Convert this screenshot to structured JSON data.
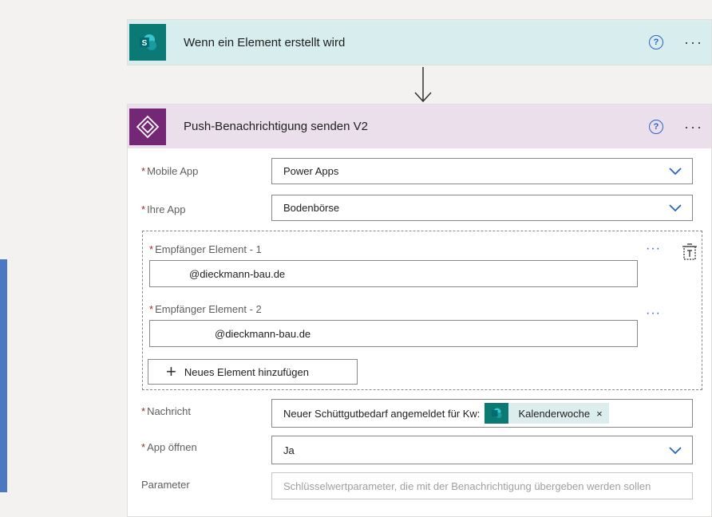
{
  "trigger": {
    "title": "Wenn ein Element erstellt wird",
    "icon": "sharepoint-icon",
    "help": "?",
    "more": "···"
  },
  "action": {
    "title": "Push-Benachrichtigung senden V2",
    "icon": "powerapps-icon",
    "help": "?",
    "more": "···",
    "required_marker": "*",
    "mobile_app": {
      "label": "Mobile App",
      "value": "Power Apps"
    },
    "ihre_app": {
      "label": "Ihre App",
      "value": "Bodenbörse"
    },
    "recipients": [
      {
        "label": "Empfänger Element - 1",
        "value": "@dieckmann-bau.de",
        "more": "···"
      },
      {
        "label": "Empfänger Element - 2",
        "value": "@dieckmann-bau.de",
        "more": "···"
      }
    ],
    "add_element_label": "Neues Element hinzufügen",
    "add_plus": "+",
    "nachricht": {
      "label": "Nachricht",
      "text": "Neuer Schüttgutbedarf angemeldet für Kw:",
      "token_label": "Kalenderwoche",
      "token_close": "×"
    },
    "app_oeffnen": {
      "label": "App öffnen",
      "value": "Ja"
    },
    "parameter": {
      "label": "Parameter",
      "placeholder": "Schlüsselwertparameter, die mit der Benachrichtigung übergeben werden sollen"
    }
  },
  "colors": {
    "trigger_header": "#d8edee",
    "action_header": "#ecdfec",
    "sharepoint": "#0b7a75",
    "powerapps": "#742774",
    "accent": "#2b62c8",
    "required": "#a4262c"
  }
}
